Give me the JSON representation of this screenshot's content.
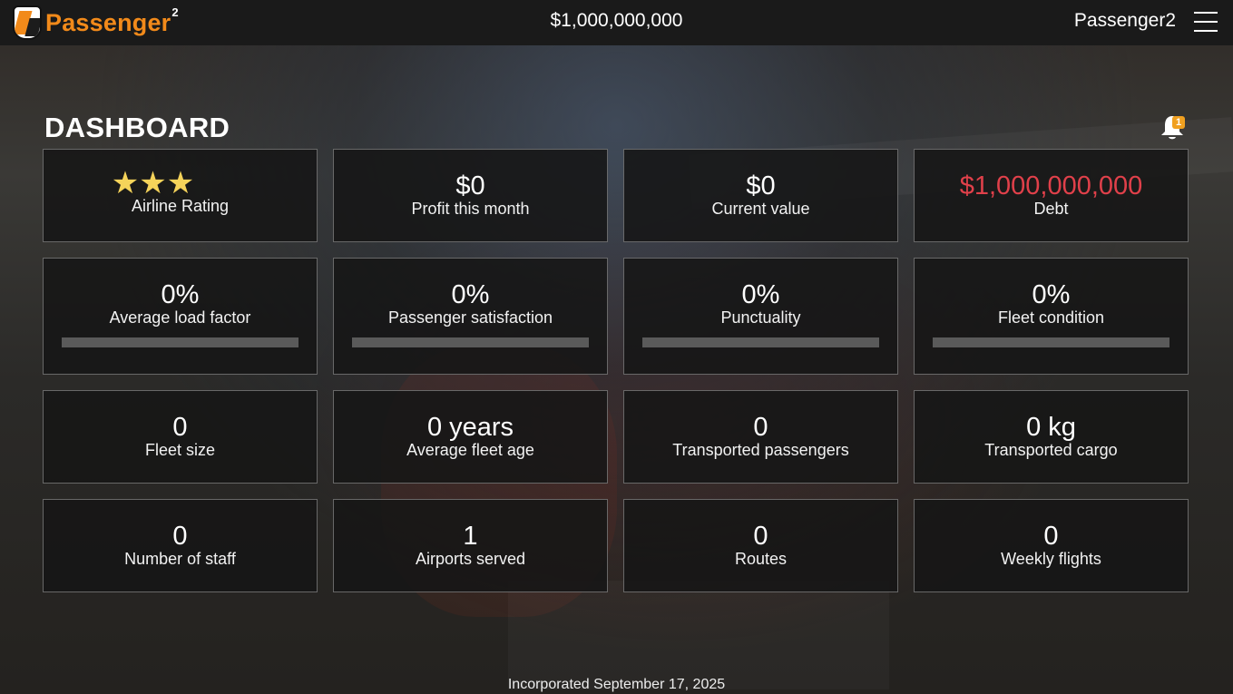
{
  "header": {
    "logo_text": "Passenger",
    "logo_sup": "2",
    "balance": "$1,000,000,000",
    "username": "Passenger2"
  },
  "dashboard": {
    "title": "DASHBOARD",
    "notification_count": "1"
  },
  "cards": {
    "rating": {
      "stars": "★★★",
      "label": "Airline Rating",
      "star_count": 3
    },
    "profit": {
      "value": "$0",
      "label": "Profit this month"
    },
    "current_value": {
      "value": "$0",
      "label": "Current value"
    },
    "debt": {
      "value": "$1,000,000,000",
      "label": "Debt"
    },
    "load_factor": {
      "value": "0%",
      "label": "Average load factor",
      "progress": 0
    },
    "satisfaction": {
      "value": "0%",
      "label": "Passenger satisfaction",
      "progress": 0
    },
    "punctuality": {
      "value": "0%",
      "label": "Punctuality",
      "progress": 0
    },
    "fleet_condition": {
      "value": "0%",
      "label": "Fleet condition",
      "progress": 0
    },
    "fleet_size": {
      "value": "0",
      "label": "Fleet size"
    },
    "fleet_age": {
      "value": "0 years",
      "label": "Average fleet age"
    },
    "passengers": {
      "value": "0",
      "label": "Transported passengers"
    },
    "cargo": {
      "value": "0 kg",
      "label": "Transported cargo"
    },
    "staff": {
      "value": "0",
      "label": "Number of staff"
    },
    "airports": {
      "value": "1",
      "label": "Airports served"
    },
    "routes": {
      "value": "0",
      "label": "Routes"
    },
    "weekly_flights": {
      "value": "0",
      "label": "Weekly flights"
    }
  },
  "footer": {
    "incorporated": "Incorporated September 17, 2025"
  },
  "colors": {
    "accent": "#f28a1a",
    "debt": "#e0404a",
    "star": "#f5d35a",
    "badge": "#f0a020"
  }
}
